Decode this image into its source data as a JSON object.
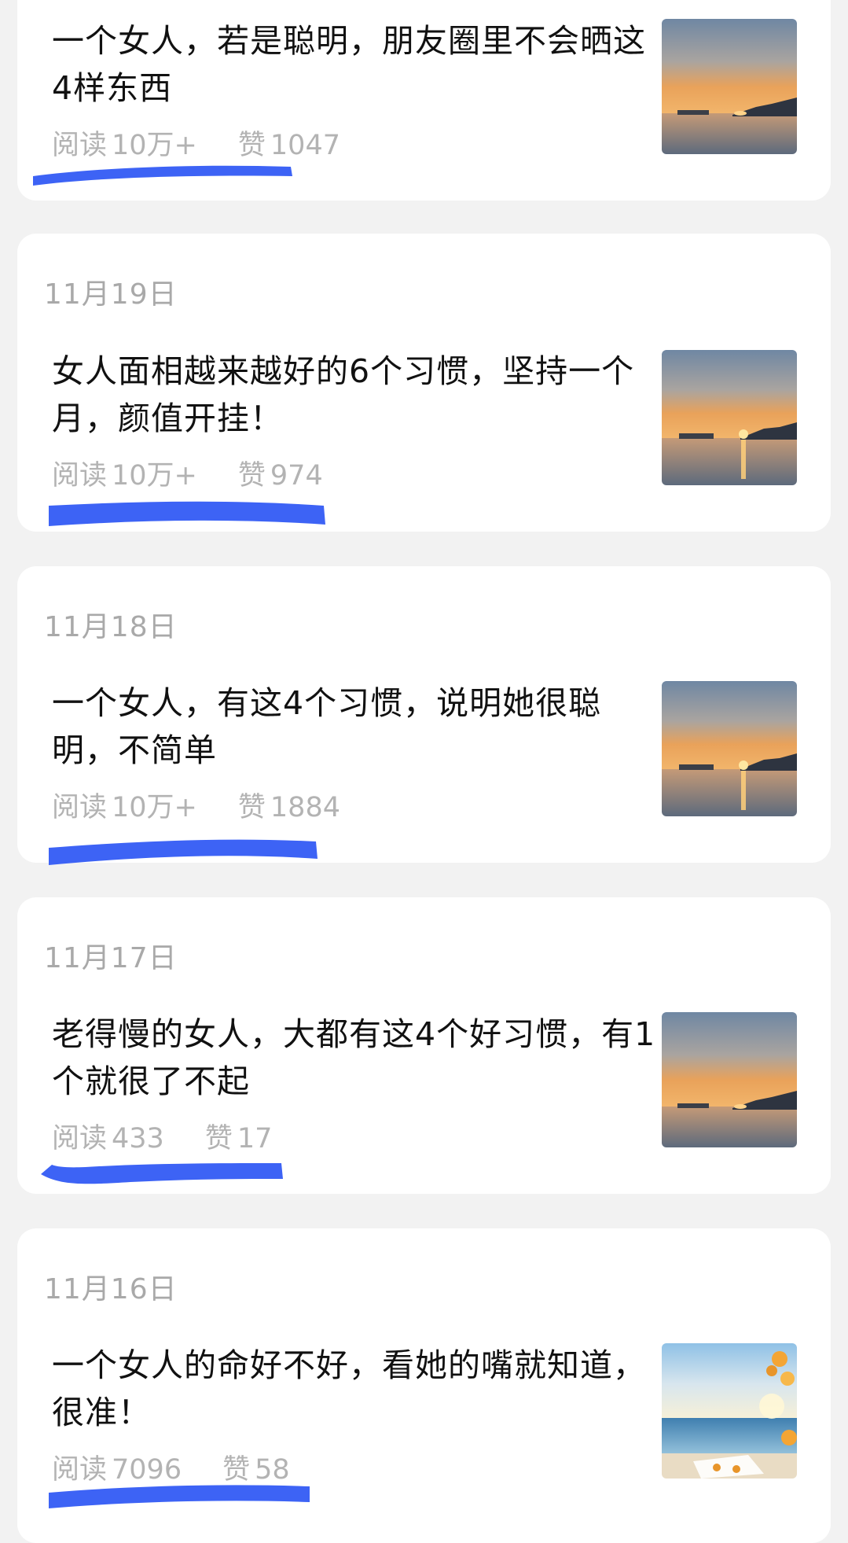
{
  "articles": [
    {
      "date": "",
      "title": "一个女人，若是聪明，朋友圈里不会晒这4样东西",
      "read_label": "阅读",
      "reads": "10万+",
      "like_label": "赞",
      "likes": "1047",
      "thumb": "sunset-lake"
    },
    {
      "date": "11月19日",
      "title": "女人面相越来越好的6个习惯，坚持一个月，颜值开挂！",
      "read_label": "阅读",
      "reads": "10万+",
      "like_label": "赞",
      "likes": "974",
      "thumb": "sunset-lake"
    },
    {
      "date": "11月18日",
      "title": "一个女人，有这4个习惯，说明她很聪明，不简单",
      "read_label": "阅读",
      "reads": "10万+",
      "like_label": "赞",
      "likes": "1884",
      "thumb": "sunset-lake"
    },
    {
      "date": "11月17日",
      "title": "老得慢的女人，大都有这4个好习惯，有1个就很了不起",
      "read_label": "阅读",
      "reads": "433",
      "like_label": "赞",
      "likes": "17",
      "thumb": "sunset-lake"
    },
    {
      "date": "11月16日",
      "title": "一个女人的命好不好，看她的嘴就知道，很准！",
      "read_label": "阅读",
      "reads": "7096",
      "like_label": "赞",
      "likes": "58",
      "thumb": "beach-flowers"
    }
  ],
  "colors": {
    "highlight": "#3d63f5",
    "meta": "#b3b3b3",
    "date": "#a9a9a9",
    "card": "#ffffff",
    "background": "#f2f2f2"
  }
}
